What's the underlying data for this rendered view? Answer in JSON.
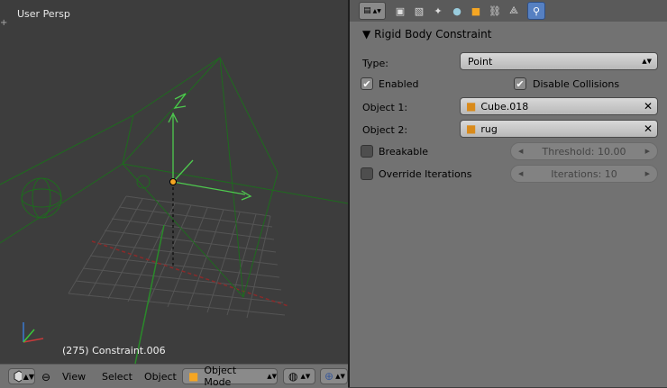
{
  "viewport": {
    "label": "User Persp",
    "corner_glyph": "+",
    "status": "(275) Constraint.006"
  },
  "bottom_bar": {
    "menus": [
      "View",
      "Select",
      "Object"
    ],
    "mode": "Object Mode"
  },
  "panel": {
    "section_title": "Rigid Body Constraint",
    "type_label": "Type:",
    "type_value": "Point",
    "enabled_label": "Enabled",
    "enabled_checked": true,
    "disable_collisions_label": "Disable Collisions",
    "disable_collisions_checked": true,
    "object1_label": "Object 1:",
    "object1_value": "Cube.018",
    "object2_label": "Object 2:",
    "object2_value": "rug",
    "breakable_label": "Breakable",
    "threshold_label": "Threshold: 10.00",
    "override_iterations_label": "Override Iterations",
    "iterations_label": "Iterations: 10"
  },
  "colors": {
    "active_tab": "#5680c2",
    "wireframe": "#1e6b1e",
    "axis_green": "#4ec94e"
  }
}
